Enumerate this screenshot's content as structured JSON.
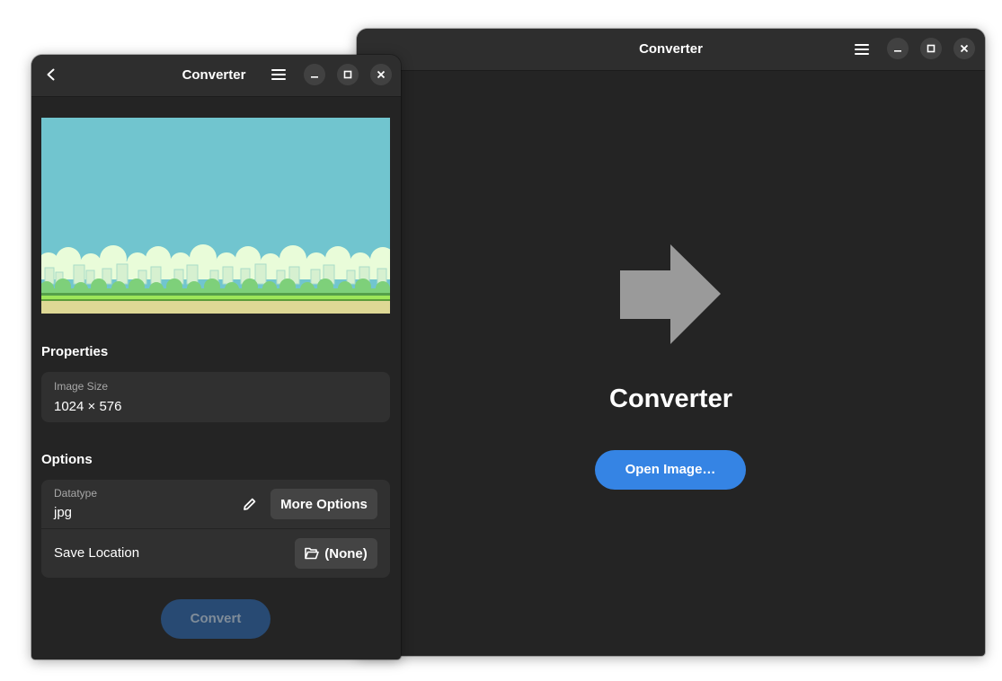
{
  "back_window": {
    "title": "Converter",
    "app_name": "Converter",
    "open_button": "Open Image…"
  },
  "front_window": {
    "title": "Converter",
    "properties": {
      "heading": "Properties",
      "image_size_label": "Image Size",
      "image_size_value": "1024 × 576"
    },
    "options": {
      "heading": "Options",
      "datatype_label": "Datatype",
      "datatype_value": "jpg",
      "more_options": "More Options",
      "save_location_label": "Save Location",
      "save_location_value": "(None)"
    },
    "convert_button": "Convert"
  },
  "colors": {
    "accent": "#3584e4",
    "window_bg": "#242424",
    "card_bg": "#303030",
    "convert_disabled": "#284a73"
  },
  "icons": [
    "back-arrow-icon",
    "menu-icon",
    "minimize-icon",
    "maximize-icon",
    "close-icon",
    "arrow-right-icon",
    "pencil-icon",
    "folder-open-icon"
  ]
}
